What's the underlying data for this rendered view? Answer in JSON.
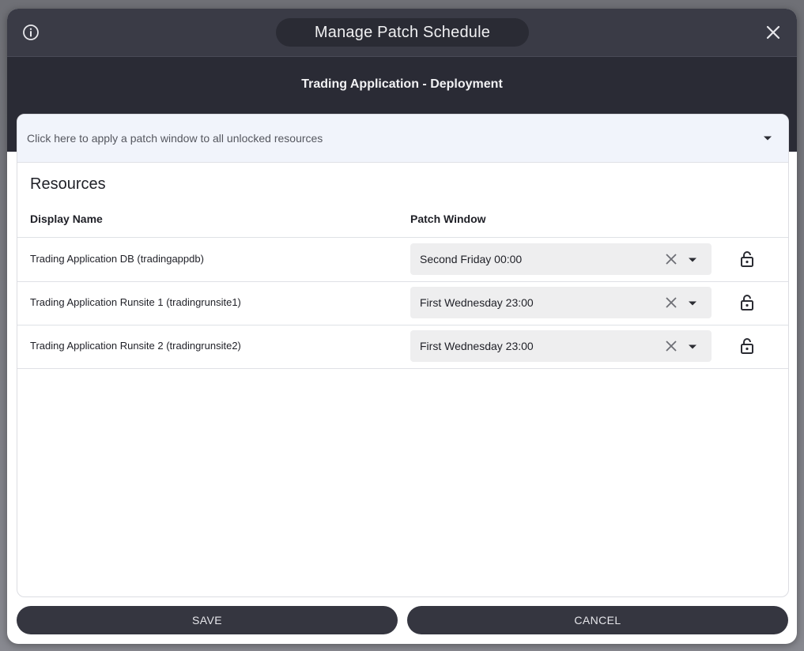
{
  "dialog": {
    "title": "Manage Patch Schedule",
    "subtitle": "Trading Application - Deployment"
  },
  "apply_all": {
    "text": "Click here to apply a patch window to all unlocked resources"
  },
  "resources": {
    "section_title": "Resources",
    "columns": [
      "Display Name",
      "Patch Window"
    ],
    "rows": [
      {
        "name": "Trading Application DB (tradingappdb)",
        "patch_window": "Second Friday 00:00",
        "locked": false
      },
      {
        "name": "Trading Application Runsite 1 (tradingrunsite1)",
        "patch_window": "First Wednesday 23:00",
        "locked": false
      },
      {
        "name": "Trading Application Runsite 2 (tradingrunsite2)",
        "patch_window": "First Wednesday 23:00",
        "locked": false
      }
    ]
  },
  "footer": {
    "save_label": "SAVE",
    "cancel_label": "CANCEL"
  },
  "icons": {
    "info": "info-icon",
    "close": "close-icon",
    "dropdown": "chevron-down-icon",
    "clear": "clear-icon",
    "lock": "unlock-icon"
  },
  "colors": {
    "titlebar": "#3a3b46",
    "subheader": "#2a2b35",
    "button": "#353640",
    "apply_bar": "#f1f4fb",
    "select_bg": "#eeeeef"
  }
}
